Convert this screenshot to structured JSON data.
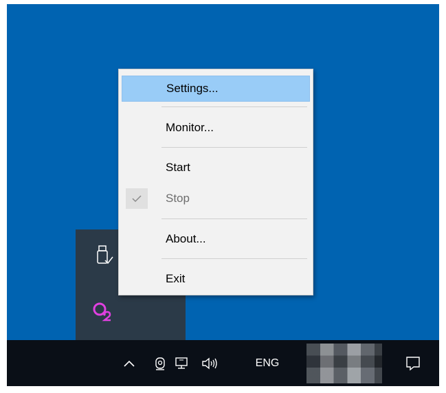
{
  "context_menu": {
    "items": [
      {
        "label": "Settings...",
        "highlighted": true,
        "enabled": true,
        "checked": false
      },
      {
        "label": "Monitor...",
        "highlighted": false,
        "enabled": true,
        "checked": false
      },
      {
        "label": "Start",
        "highlighted": false,
        "enabled": true,
        "checked": false
      },
      {
        "label": "Stop",
        "highlighted": false,
        "enabled": false,
        "checked": true
      },
      {
        "label": "About...",
        "highlighted": false,
        "enabled": true,
        "checked": false
      },
      {
        "label": "Exit",
        "highlighted": false,
        "enabled": true,
        "checked": false
      }
    ]
  },
  "tray_flyout": {
    "icons": [
      "usb-drive-icon",
      "q2-app-icon"
    ]
  },
  "taskbar": {
    "icons": [
      "chevron-up-icon",
      "webcam-icon",
      "network-icon",
      "volume-icon",
      "notification-icon"
    ],
    "language": "ENG"
  },
  "colors": {
    "desktop": "#0063b1",
    "taskbar": "#0a0f17",
    "flyout": "#2b3a48",
    "menu_highlight": "#99ccf7",
    "q2_accent": "#e040e0"
  }
}
